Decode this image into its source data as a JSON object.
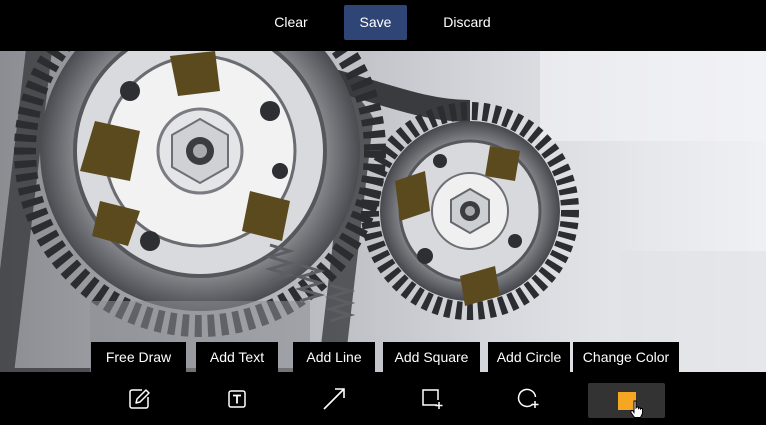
{
  "topbar": {
    "clear_label": "Clear",
    "save_label": "Save",
    "discard_label": "Discard"
  },
  "tooltips": {
    "free_draw": "Free Draw",
    "add_text": "Add Text",
    "add_line": "Add Line",
    "add_square": "Add Square",
    "add_circle": "Add Circle",
    "change_color": "Change Color"
  },
  "toolbar": {
    "icons": [
      "pencil-icon",
      "text-icon",
      "line-icon",
      "square-add-icon",
      "circle-add-icon",
      "color-swatch"
    ],
    "selected_color": "#f5a623"
  },
  "colors": {
    "save_bg": "#2f4576",
    "toolbar_bg": "#000000",
    "selected_tool_bg": "#333333"
  }
}
